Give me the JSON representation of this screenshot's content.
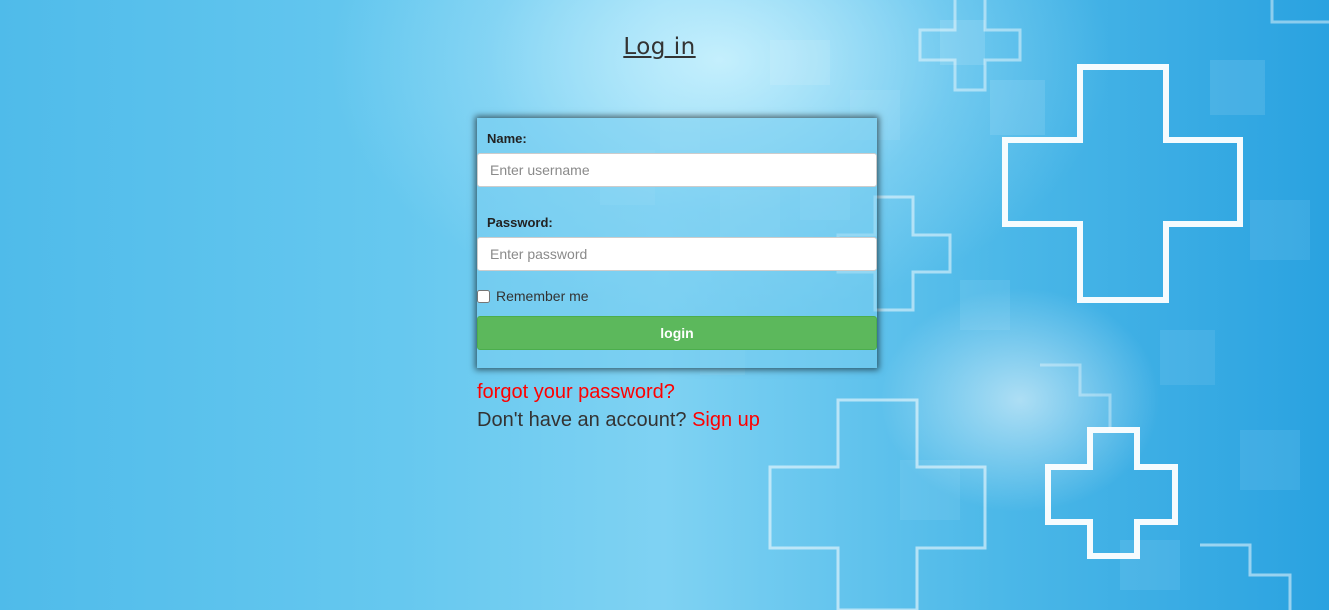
{
  "page": {
    "title": "Log in"
  },
  "form": {
    "name_label": "Name:",
    "name_placeholder": "Enter username",
    "name_value": "",
    "password_label": "Password:",
    "password_placeholder": "Enter password",
    "password_value": "",
    "remember_label": "Remember me",
    "remember_checked": false,
    "login_label": "login"
  },
  "links": {
    "forgot_password": "forgot your password?",
    "no_account_text": "Don't have an account?",
    "sign_up": "Sign up"
  },
  "colors": {
    "background": "#5cc3ee",
    "login_button": "#5cb85c",
    "link": "#ff0000",
    "title_text": "#333333"
  },
  "icons": {
    "background_decoration": "medical-cross-icon"
  }
}
